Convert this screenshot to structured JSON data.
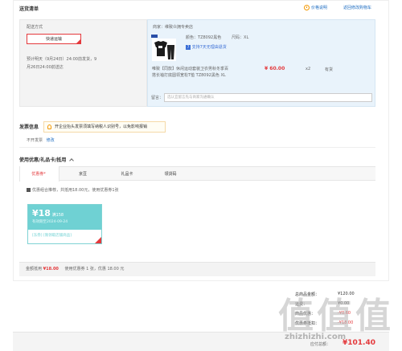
{
  "header": {
    "title": "送货清单",
    "price_note": "价格说明",
    "back_to_cart": "返回修改购物车"
  },
  "shipping": {
    "label": "配送方式",
    "method_button": "快递运输",
    "eta_line1": "预计明天（9月24日）24:00前发货，9",
    "eta_line2": "月26日24:00前送达"
  },
  "shop": {
    "merchant_label": "商家：",
    "merchant_name": "维致众拥专卖店",
    "color_label": "颜色：",
    "color_value": "TZ8092黑色",
    "size_label": "尺码：",
    "size_value": "XL",
    "return_badge": "7",
    "return_text": "支持7天无理由退货",
    "product_title_line1": "唯致【同款】休闲运动套装卫衣男秋冬季百",
    "product_title_line2": "搭长袖打底圆领宽松T恤 TZ8092黑色 XL",
    "price": "¥ 60.00",
    "quantity": "x2",
    "stock": "有货",
    "note_label": "留言：",
    "note_placeholder": "选认宜留言先与商家沟通确认"
  },
  "invoice": {
    "title": "发票信息",
    "tip": "开企业抬头发票须填写纳税人识别号，以免影响报销",
    "status": "不开发票",
    "modify": "修改"
  },
  "discount": {
    "title": "使用优惠/礼品卡/抵用",
    "tabs": [
      "优惠券",
      "京豆",
      "礼品卡",
      "领货码"
    ],
    "active_tab_marker": "*",
    "checkbox_label": "优惠组合推荐，共抵用18.00元，使用优惠券1张",
    "coupon": {
      "amount": "¥18",
      "condition": "满158",
      "validity": "有效期至2024-09-24",
      "kind": "[东券]",
      "scope": "[限领取店铺商品]"
    },
    "summary_prefix": "金额抵用",
    "summary_amount": "¥18.00",
    "summary_suffix": "使用优惠券 1 张，优惠 18.00 元"
  },
  "fees": {
    "rows": [
      {
        "label": "总商品金额：",
        "value": "¥120.00"
      },
      {
        "label": "运费：",
        "value": "¥0.00"
      },
      {
        "label": "商品优惠：",
        "value": "-¥0.60"
      },
      {
        "label": "优惠券抵扣：",
        "value": "-¥18.00"
      }
    ],
    "total_label": "应付总额：",
    "total_value": "¥101.40"
  },
  "watermark": {
    "text": "值值值",
    "url": "zhizhizhi.com"
  },
  "colors": {
    "accent_red": "#e4393c",
    "link_blue": "#1e6dc2",
    "coupon_teal": "#6fd1d3",
    "shop_bg": "#e9f3fb"
  }
}
